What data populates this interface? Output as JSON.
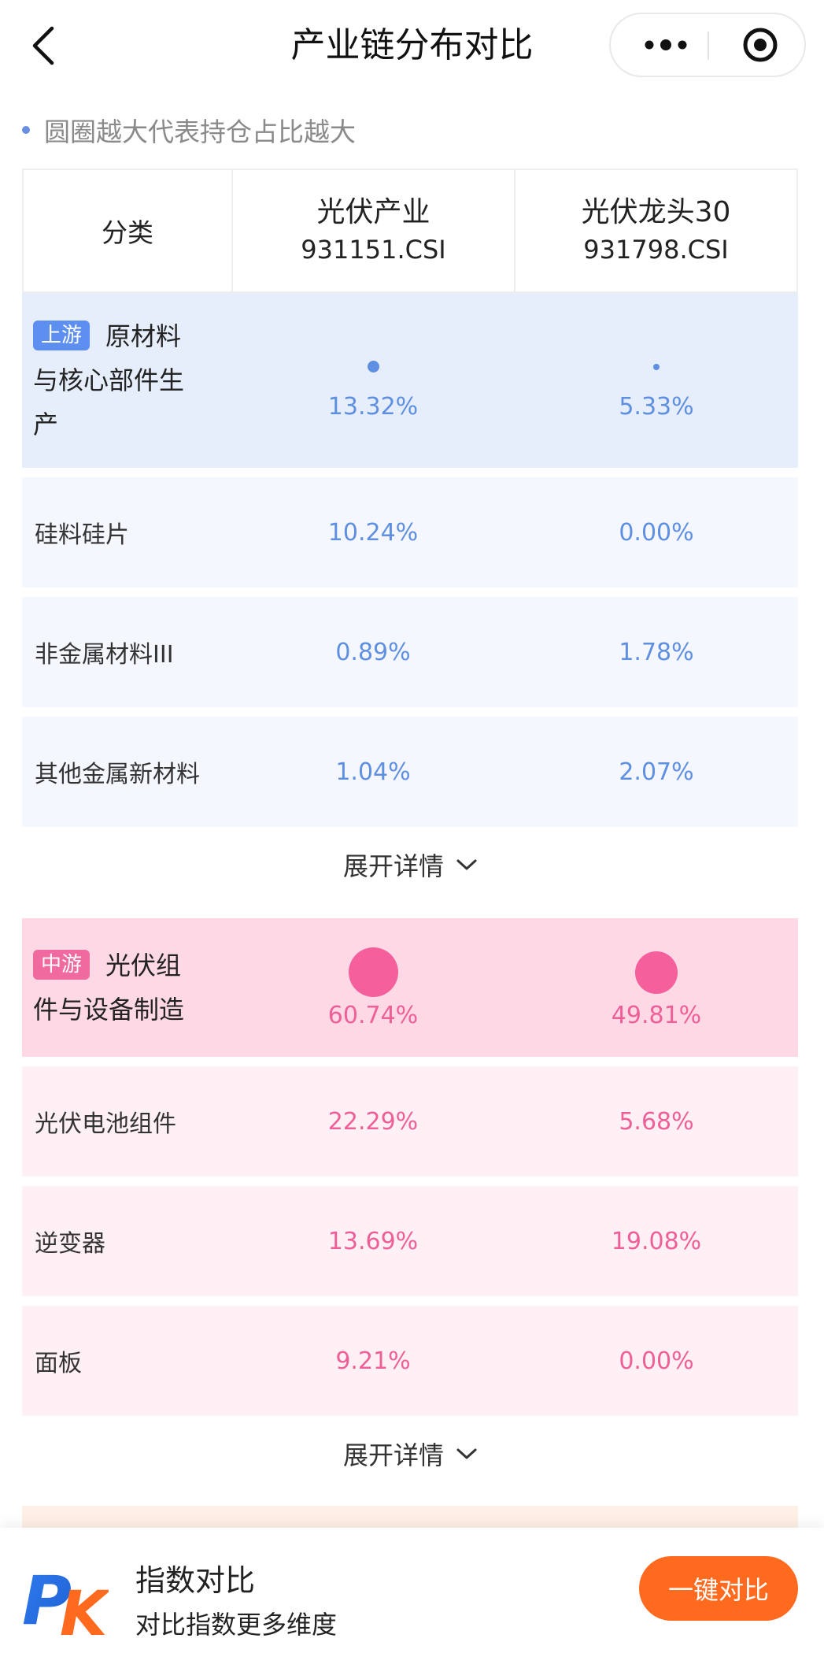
{
  "nav": {
    "title": "产业链分布对比"
  },
  "legend": {
    "text": "圆圈越大代表持仓占比越大"
  },
  "table": {
    "header": {
      "category": "分类",
      "col1_name": "光伏产业",
      "col1_code": "931151.CSI",
      "col2_name": "光伏龙头30",
      "col2_code": "931798.CSI"
    },
    "upstream": {
      "tag": "上游",
      "title_line1": "原材料",
      "title_line2": "与核心部件生",
      "title_line3": "产",
      "v1": "13.32%",
      "v2": "5.33%",
      "rows": [
        {
          "label": "硅料硅片",
          "v1": "10.24%",
          "v2": "0.00%"
        },
        {
          "label": "非金属材料III",
          "v1": "0.89%",
          "v2": "1.78%"
        },
        {
          "label": "其他金属新材料",
          "v1": "1.04%",
          "v2": "2.07%"
        }
      ],
      "expand": "展开详情"
    },
    "midstream": {
      "tag": "中游",
      "title_line1": "光伏组",
      "title_line2": "件与设备制造",
      "v1": "60.74%",
      "v2": "49.81%",
      "rows": [
        {
          "label": "光伏电池组件",
          "v1": "22.29%",
          "v2": "5.68%"
        },
        {
          "label": "逆变器",
          "v1": "13.69%",
          "v2": "19.08%"
        },
        {
          "label": "面板",
          "v1": "9.21%",
          "v2": "0.00%"
        }
      ],
      "expand": "展开详情"
    }
  },
  "bottom": {
    "logo_text": "PK",
    "title": "指数对比",
    "subtitle": "对比指数更多维度",
    "button": "一键对比"
  },
  "colors": {
    "upstream": "#5f8fe0",
    "midstream": "#ef5f97",
    "button": "#ff6a1f"
  }
}
